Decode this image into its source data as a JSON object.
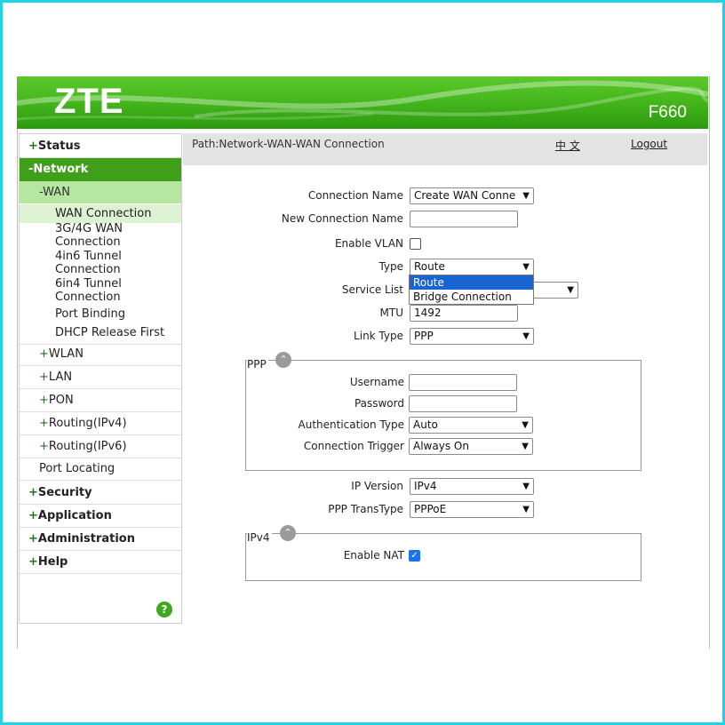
{
  "header": {
    "logo": "ZTE",
    "model": "F660"
  },
  "sidebar": {
    "status": "Status",
    "network": "-Network",
    "wan": "-WAN",
    "wan_items": [
      "WAN Connection",
      "3G/4G WAN",
      "Connection",
      "4in6 Tunnel",
      "Connection",
      "6in4 Tunnel",
      "Connection",
      "Port Binding",
      "DHCP Release First"
    ],
    "network_items": [
      "WLAN",
      "LAN",
      "PON",
      "Routing(IPv4)",
      "Routing(IPv6)"
    ],
    "port_locating": "Port Locating",
    "security": "Security",
    "application": "Application",
    "administration": "Administration",
    "help": "Help",
    "help_icon": "?"
  },
  "pathbar": {
    "path": "Path:Network-WAN-WAN Connection",
    "lang": "中 文",
    "logout": "Logout"
  },
  "form": {
    "connection_name_label": "Connection Name",
    "connection_name_value": "Create WAN Conne",
    "new_connection_name_label": "New Connection Name",
    "new_connection_name_value": "",
    "enable_vlan_label": "Enable VLAN",
    "type_label": "Type",
    "type_value": "Route",
    "type_options": [
      "Route",
      "Bridge Connection"
    ],
    "service_list_label": "Service List",
    "mtu_label": "MTU",
    "mtu_value": "1492",
    "link_type_label": "Link Type",
    "link_type_value": "PPP",
    "ppp": {
      "legend": "PPP",
      "username_label": "Username",
      "password_label": "Password",
      "auth_type_label": "Authentication Type",
      "auth_type_value": "Auto",
      "trigger_label": "Connection Trigger",
      "trigger_value": "Always On"
    },
    "ip_version_label": "IP Version",
    "ip_version_value": "IPv4",
    "ppp_transtype_label": "PPP TransType",
    "ppp_transtype_value": "PPPoE",
    "ipv4": {
      "legend": "IPv4",
      "enable_nat_label": "Enable NAT",
      "enable_nat_checked": true
    }
  },
  "icons": {
    "collapse": "chevron-up-icon",
    "arrow": "chevron-down-icon",
    "check": "checkmark-icon"
  },
  "colors": {
    "brand_green": "#46b81d",
    "nav_active": "#3f9e1a",
    "nav_wan": "#b6e6a0",
    "frame": "#22d3e6",
    "highlight": "#1a64d2"
  }
}
